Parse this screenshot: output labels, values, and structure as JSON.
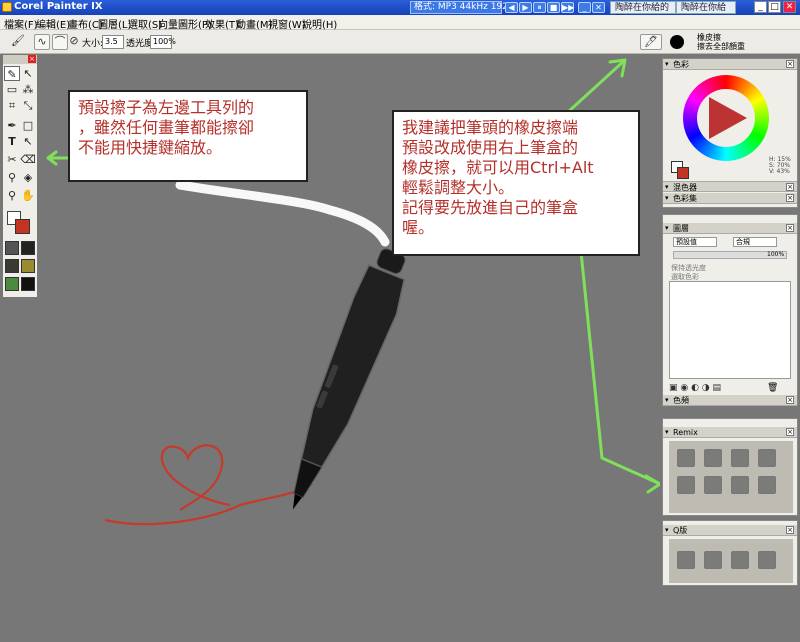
{
  "window": {
    "title": "Corel Painter IX",
    "media_text": "格式: MP3 44kHz 192K",
    "media_buttons": [
      "◀",
      "▶",
      "⏸",
      "■",
      "▶▶",
      "_",
      "✕"
    ],
    "ie_tab_1": "陶醉在你給的甜蜜",
    "ie_tab_2": "陶醉在你給",
    "win_min": "_",
    "win_max": "□",
    "win_close": "✕"
  },
  "menu": [
    "檔案(F)",
    "編輯(E)",
    "畫布(C)",
    "圖層(L)",
    "選取(S)",
    "向量圖形(P)",
    "效果(T)",
    "動畫(M)",
    "視窗(W)",
    "說明(H)"
  ],
  "propbar": {
    "size_label": "大小:",
    "size_value": "3.5",
    "opacity_label": "透光度:",
    "opacity_value": "100%",
    "brush_category": "橡皮擦",
    "brush_variant": "擦去全部顏重"
  },
  "notes": {
    "left_line1": "預設擦子為左邊工具列的",
    "left_line2": "，雖然任何畫筆都能擦卻",
    "left_line3": "不能用快捷鍵縮放。",
    "right_line1": "我建議把筆頭的橡皮擦端",
    "right_line2": "預設改成使用右上筆盒的",
    "right_line3": "橡皮擦，就可以用Ctrl+Alt",
    "right_line4": "輕鬆調整大小。",
    "right_line5": "記得要先放進自己的筆盒",
    "right_line6": "喔。"
  },
  "panels": {
    "color": "色彩",
    "color_readout": [
      "H: 15%",
      "S: 70%",
      "V: 43%"
    ],
    "mixer": "混色器",
    "color_set": "色彩集",
    "layers": "圖層",
    "layer_blend": "預設值",
    "layer_composite": "合規",
    "layer_opacity": "100%",
    "preserve_transparency": "保持透光度",
    "pick_up_color": "選取色彩",
    "channels": "色頻",
    "custom1": "Remix",
    "custom2": "Q版"
  },
  "colors": {
    "accent": "#b5302a",
    "highlight": "#7fe05a",
    "foreground": "#c33522",
    "heart": "#c53a2a"
  }
}
